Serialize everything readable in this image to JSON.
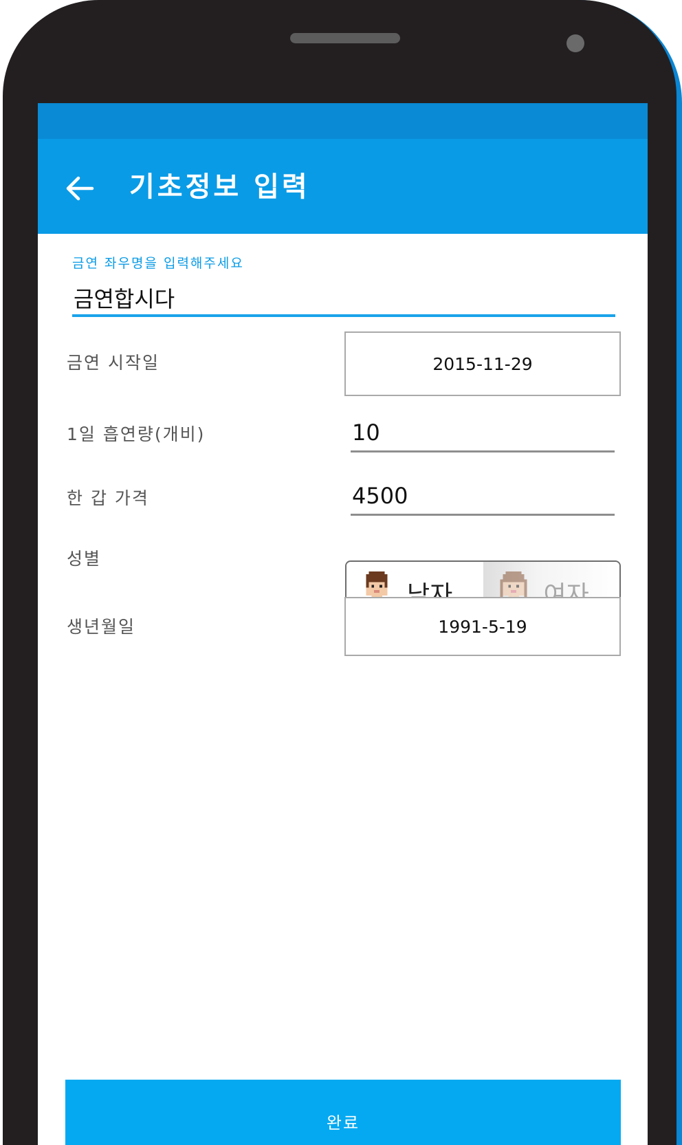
{
  "app_bar": {
    "title": "기초정보 입력",
    "back_icon": "arrow-left-icon"
  },
  "name_field": {
    "label": "금연 좌우명을 입력해주세요",
    "value": "금연합시다"
  },
  "quit_start_date": {
    "label": "금연 시작일",
    "value": "2015-11-29"
  },
  "daily_cigarettes": {
    "label": "1일 흡연량(개비)",
    "value": "10"
  },
  "pack_price": {
    "label": "한 갑 가격",
    "value": "4500"
  },
  "gender": {
    "label": "성별",
    "options": [
      {
        "label": "남자",
        "icon": "male-avatar-icon",
        "selected": true
      },
      {
        "label": "여자",
        "icon": "female-avatar-icon",
        "selected": false
      }
    ]
  },
  "birth_date": {
    "label": "생년월일",
    "value": "1991-5-19"
  },
  "done_button": {
    "label": "완료"
  },
  "colors": {
    "status_bar": "#0a8ad4",
    "app_bar": "#0a9be6",
    "accent": "#1aa3ea",
    "button": "#04a9f1",
    "phone_frame": "#231f20"
  }
}
